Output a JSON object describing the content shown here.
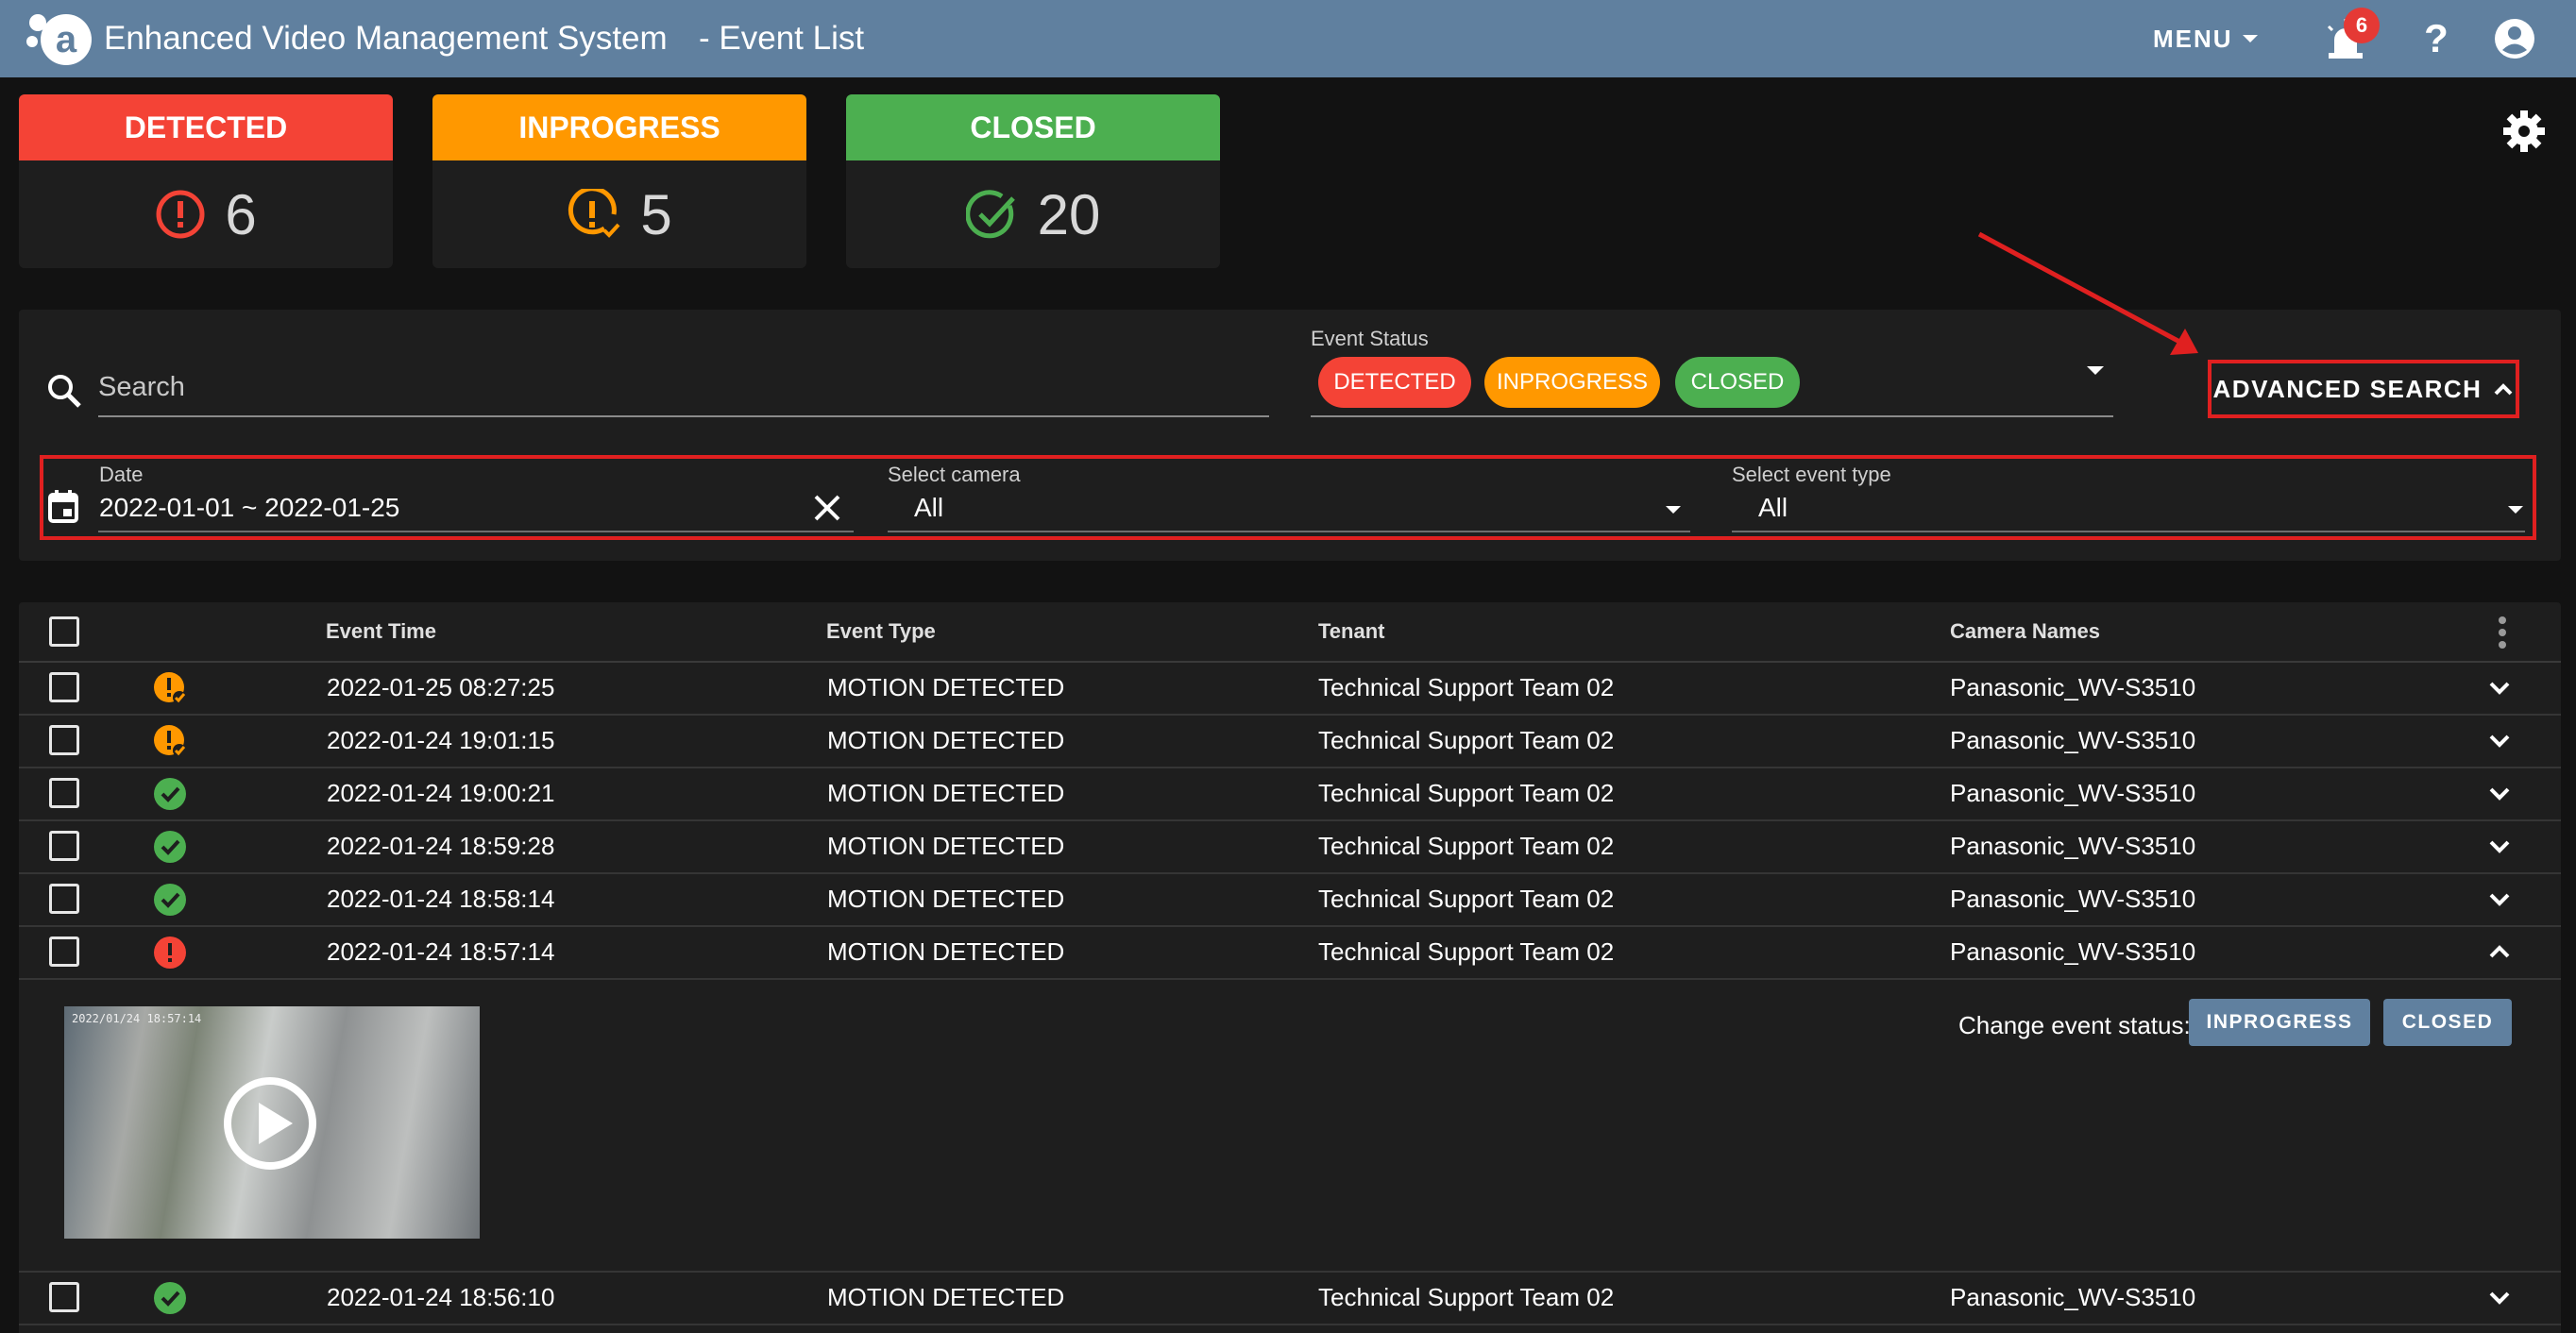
{
  "header": {
    "logo_text": "a",
    "app_title": "Enhanced Video Management System",
    "page_title": "- Event List",
    "menu_label": "MENU",
    "notification_count": "6",
    "help_label": "?",
    "bar_color": "#60809f"
  },
  "status_cards": [
    {
      "label": "DETECTED",
      "count": "6",
      "color": "#f44336",
      "icon": "alert-circle-icon"
    },
    {
      "label": "INPROGRESS",
      "count": "5",
      "color": "#ff9800",
      "icon": "alert-progress-icon"
    },
    {
      "label": "CLOSED",
      "count": "20",
      "color": "#4caf50",
      "icon": "check-circle-icon"
    }
  ],
  "filters": {
    "search_placeholder": "Search",
    "event_status_label": "Event Status",
    "event_status_chips": [
      {
        "label": "DETECTED",
        "color": "#f44336"
      },
      {
        "label": "INPROGRESS",
        "color": "#ff9800"
      },
      {
        "label": "CLOSED",
        "color": "#4caf50"
      }
    ],
    "advanced_search_label": "ADVANCED SEARCH",
    "date_label": "Date",
    "date_value": "2022-01-01 ~ 2022-01-25",
    "camera_label": "Select camera",
    "camera_value": "All",
    "event_type_label": "Select event type",
    "event_type_value": "All"
  },
  "table": {
    "columns": [
      "Event Time",
      "Event Type",
      "Tenant",
      "Camera Names"
    ],
    "rows": [
      {
        "status": "inprogress",
        "time": "2022-01-25 08:27:25",
        "type": "MOTION DETECTED",
        "tenant": "Technical Support Team 02",
        "camera": "Panasonic_WV-S3510",
        "expanded": false
      },
      {
        "status": "inprogress",
        "time": "2022-01-24 19:01:15",
        "type": "MOTION DETECTED",
        "tenant": "Technical Support Team 02",
        "camera": "Panasonic_WV-S3510",
        "expanded": false
      },
      {
        "status": "closed",
        "time": "2022-01-24 19:00:21",
        "type": "MOTION DETECTED",
        "tenant": "Technical Support Team 02",
        "camera": "Panasonic_WV-S3510",
        "expanded": false
      },
      {
        "status": "closed",
        "time": "2022-01-24 18:59:28",
        "type": "MOTION DETECTED",
        "tenant": "Technical Support Team 02",
        "camera": "Panasonic_WV-S3510",
        "expanded": false
      },
      {
        "status": "closed",
        "time": "2022-01-24 18:58:14",
        "type": "MOTION DETECTED",
        "tenant": "Technical Support Team 02",
        "camera": "Panasonic_WV-S3510",
        "expanded": false
      },
      {
        "status": "detected",
        "time": "2022-01-24 18:57:14",
        "type": "MOTION DETECTED",
        "tenant": "Technical Support Team 02",
        "camera": "Panasonic_WV-S3510",
        "expanded": true
      },
      {
        "status": "closed",
        "time": "2022-01-24 18:56:10",
        "type": "MOTION DETECTED",
        "tenant": "Technical Support Team 02",
        "camera": "Panasonic_WV-S3510",
        "expanded": false
      }
    ],
    "detail": {
      "video_timestamp": "2022/01/24 18:57:14",
      "change_status_label": "Change event status:",
      "buttons": [
        "INPROGRESS",
        "CLOSED"
      ]
    }
  }
}
